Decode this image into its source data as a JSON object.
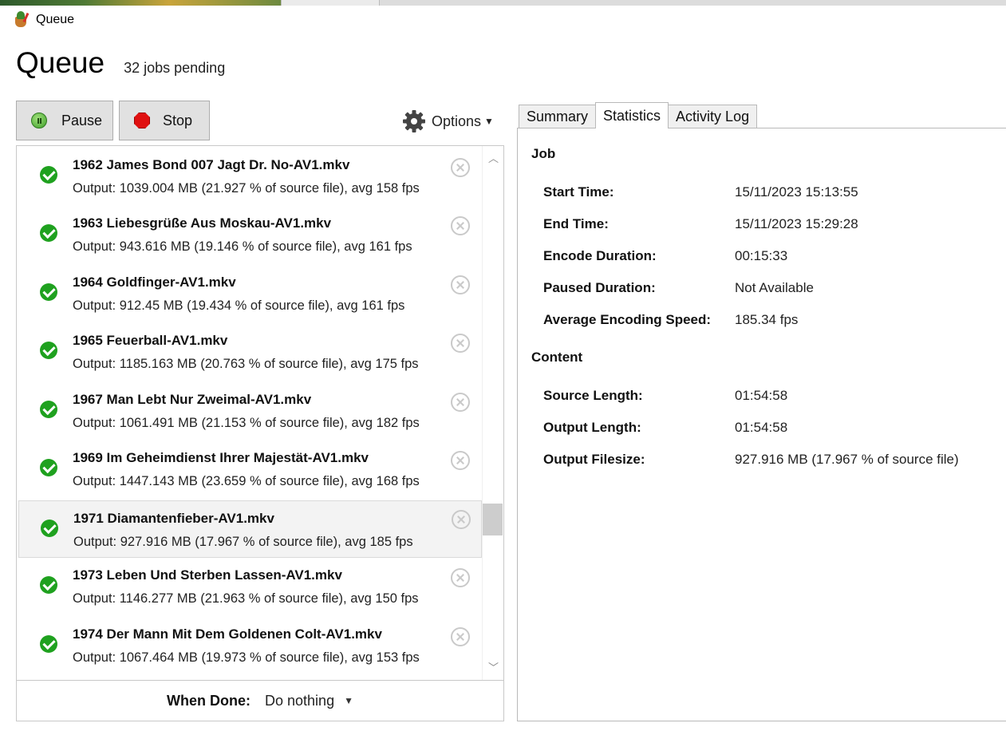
{
  "window": {
    "title": "Queue"
  },
  "header": {
    "title": "Queue",
    "subtitle": "32 jobs pending"
  },
  "toolbar": {
    "pause_label": "Pause",
    "stop_label": "Stop",
    "options_label": "Options"
  },
  "queue": {
    "items": [
      {
        "name": "1962 James Bond 007 Jagt Dr. No-AV1.mkv",
        "info": "Output: 1039.004 MB (21.927 % of source file), avg 158 fps"
      },
      {
        "name": "1963 Liebesgrüße Aus Moskau-AV1.mkv",
        "info": "Output: 943.616 MB (19.146 % of source file), avg 161 fps"
      },
      {
        "name": "1964 Goldfinger-AV1.mkv",
        "info": "Output: 912.45 MB (19.434 % of source file), avg 161 fps"
      },
      {
        "name": "1965 Feuerball-AV1.mkv",
        "info": "Output: 1185.163 MB (20.763 % of source file), avg 175 fps"
      },
      {
        "name": "1967 Man Lebt Nur Zweimal-AV1.mkv",
        "info": "Output: 1061.491 MB (21.153 % of source file), avg 182 fps"
      },
      {
        "name": "1969 Im Geheimdienst Ihrer Majestät-AV1.mkv",
        "info": "Output: 1447.143 MB (23.659 % of source file), avg 168 fps"
      },
      {
        "name": "1971 Diamantenfieber-AV1.mkv",
        "info": "Output: 927.916 MB (17.967 % of source file), avg 185 fps"
      },
      {
        "name": "1973 Leben Und Sterben Lassen-AV1.mkv",
        "info": "Output: 1146.277 MB (21.963 % of source file), avg 150 fps"
      },
      {
        "name": "1974 Der Mann Mit Dem Goldenen Colt-AV1.mkv",
        "info": "Output: 1067.464 MB (19.973 % of source file), avg 153 fps"
      }
    ],
    "selected_index": 6
  },
  "when_done": {
    "label": "When Done:",
    "value": "Do nothing"
  },
  "tabs": [
    {
      "label": "Summary",
      "active": false
    },
    {
      "label": "Statistics",
      "active": true
    },
    {
      "label": "Activity Log",
      "active": false
    }
  ],
  "statistics": {
    "job_heading": "Job",
    "job": [
      {
        "label": "Start Time:",
        "value": "15/11/2023 15:13:55"
      },
      {
        "label": "End Time:",
        "value": "15/11/2023 15:29:28"
      },
      {
        "label": "Encode Duration:",
        "value": "00:15:33"
      },
      {
        "label": "Paused Duration:",
        "value": "Not Available"
      },
      {
        "label": "Average Encoding Speed:",
        "value": "185.34 fps"
      }
    ],
    "content_heading": "Content",
    "content": [
      {
        "label": "Source Length:",
        "value": "01:54:58"
      },
      {
        "label": "Output Length:",
        "value": "01:54:58"
      },
      {
        "label": "Output Filesize:",
        "value": "927.916 MB (17.967 % of source file)"
      }
    ]
  },
  "colors": {
    "accent_green": "#1fa11f",
    "stop_red": "#e01010",
    "button_face": "#e1e1e1"
  }
}
